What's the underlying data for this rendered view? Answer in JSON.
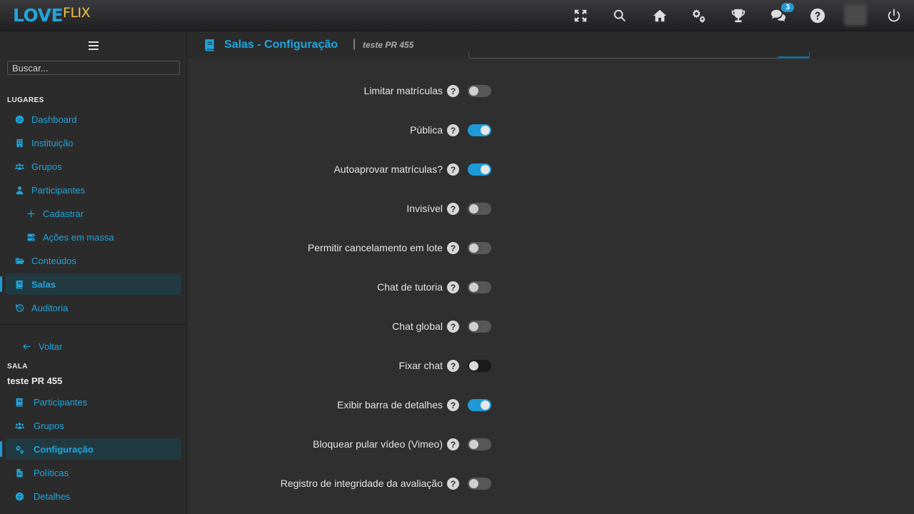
{
  "brand": {
    "part1": "LOVE",
    "part2": "FLIX"
  },
  "topbar": {
    "icons": [
      "expand-icon",
      "search-icon",
      "home-icon",
      "cogs-icon",
      "trophy-icon",
      "chat-icon",
      "help-icon",
      "power-icon"
    ],
    "chat_badge": "3"
  },
  "sidebar": {
    "search_placeholder": "Buscar...",
    "places_title": "LUGARES",
    "places": [
      {
        "label": "Dashboard",
        "icon": "dashboard-icon"
      },
      {
        "label": "Instituição",
        "icon": "building-icon"
      },
      {
        "label": "Grupos",
        "icon": "users-icon"
      },
      {
        "label": "Participantes",
        "icon": "user-icon"
      },
      {
        "label": "Cadastrar",
        "icon": "plus-icon"
      },
      {
        "label": "Ações em massa",
        "icon": "server-icon"
      },
      {
        "label": "Conteúdos",
        "icon": "folder-icon"
      },
      {
        "label": "Salas",
        "icon": "book-icon",
        "active": true
      },
      {
        "label": "Auditoria",
        "icon": "history-icon"
      }
    ],
    "back_label": "Voltar",
    "room_title": "SALA",
    "room_name": "teste PR 455",
    "room_items": [
      {
        "label": "Participantes",
        "icon": "book-icon"
      },
      {
        "label": "Grupos",
        "icon": "users-icon"
      },
      {
        "label": "Configuração",
        "icon": "cogs-icon",
        "active": true
      },
      {
        "label": "Políticas",
        "icon": "file-icon"
      },
      {
        "label": "Detalhes",
        "icon": "dashboard-icon"
      }
    ]
  },
  "header": {
    "title": "Salas - Configuração",
    "separator": "|",
    "subtitle": "teste PR 455"
  },
  "settings": [
    {
      "label": "Limitar matrículas",
      "enabled": false
    },
    {
      "label": "Pública",
      "enabled": true
    },
    {
      "label": "Autoaprovar matrículas?",
      "enabled": true
    },
    {
      "label": "Invisível",
      "enabled": false
    },
    {
      "label": "Permitir cancelamento em lote",
      "enabled": false
    },
    {
      "label": "Chat de tutoria",
      "enabled": false
    },
    {
      "label": "Chat global",
      "enabled": false
    },
    {
      "label": "Fixar chat",
      "enabled": false
    },
    {
      "label": "Exibir barra de detalhes",
      "enabled": true
    },
    {
      "label": "Bloquear pular vídeo (Vimeo)",
      "enabled": false
    },
    {
      "label": "Registro de integridade da avaliação",
      "enabled": false
    }
  ],
  "help_glyph": "?"
}
